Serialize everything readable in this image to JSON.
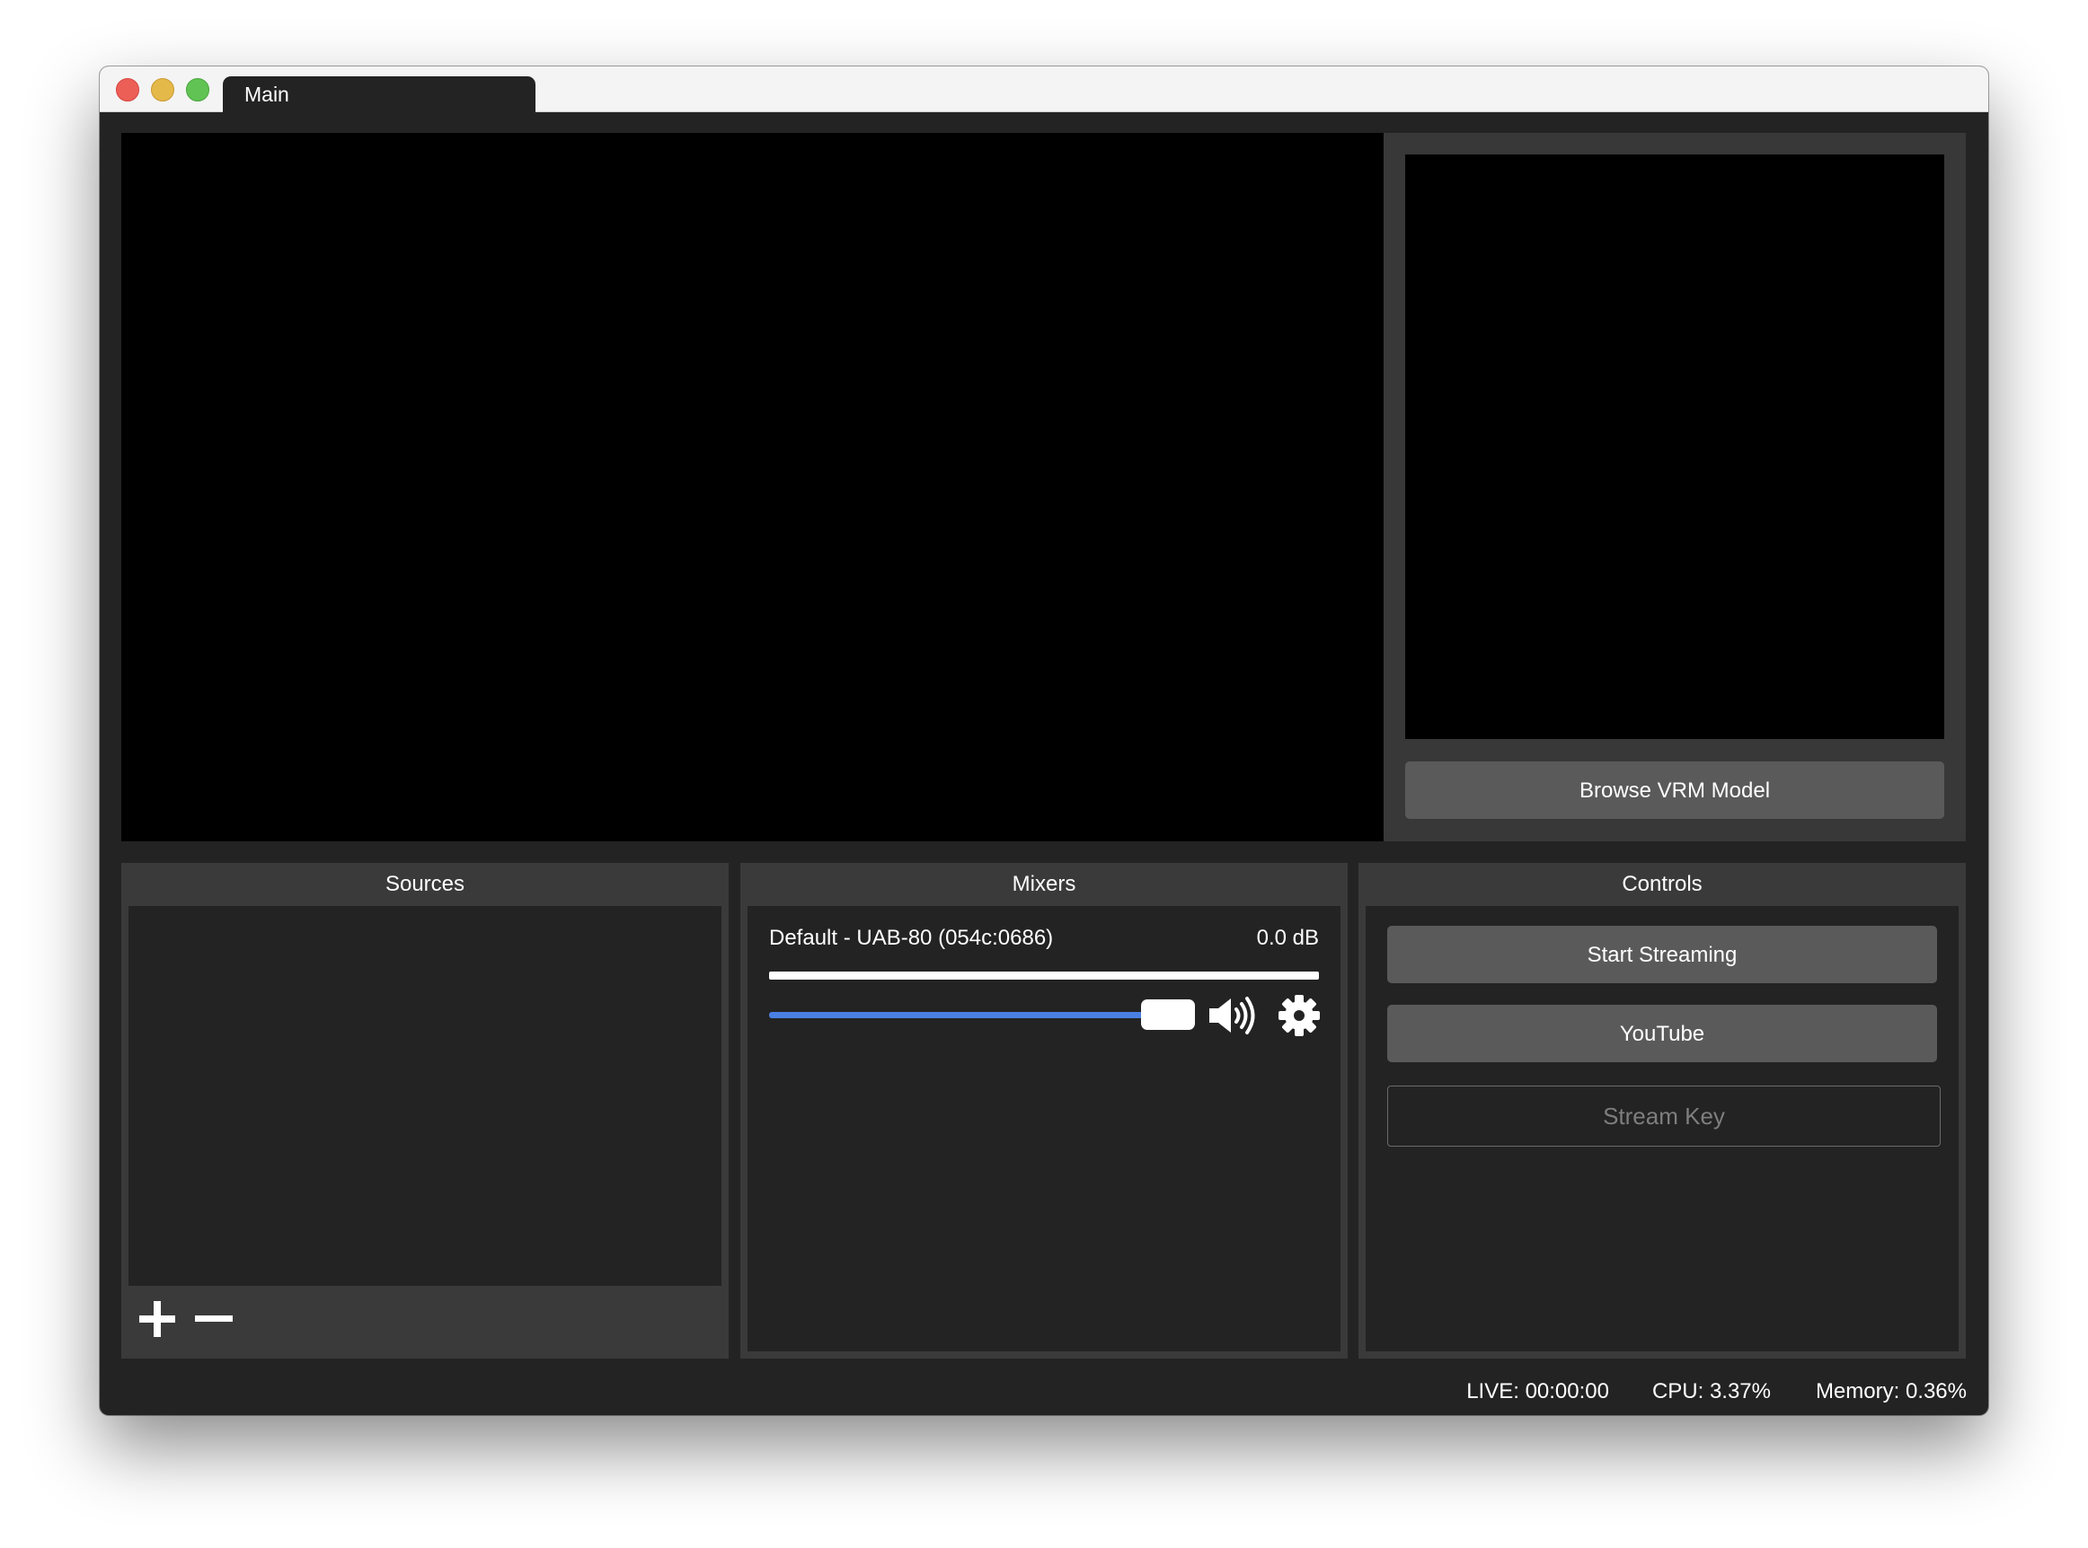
{
  "window": {
    "tab_title": "Main"
  },
  "model_panel": {
    "browse_label": "Browse VRM Model"
  },
  "sources": {
    "title": "Sources",
    "items": [],
    "add_icon": "plus-icon",
    "remove_icon": "minus-icon"
  },
  "mixers": {
    "title": "Mixers",
    "device_label": "Default - UAB-80 (054c:0686)",
    "level_db": "0.0 dB",
    "volume_fraction": 1.0,
    "meter_fraction": 1.0,
    "accent_color": "#4a7fe3",
    "mute_icon": "speaker-icon",
    "settings_icon": "gear-icon"
  },
  "controls": {
    "title": "Controls",
    "start_label": "Start Streaming",
    "service_label": "YouTube",
    "stream_key_value": "",
    "stream_key_placeholder": "Stream Key"
  },
  "status": {
    "live": "LIVE: 00:00:00",
    "cpu": "CPU: 3.37%",
    "memory": "Memory: 0.36%"
  }
}
